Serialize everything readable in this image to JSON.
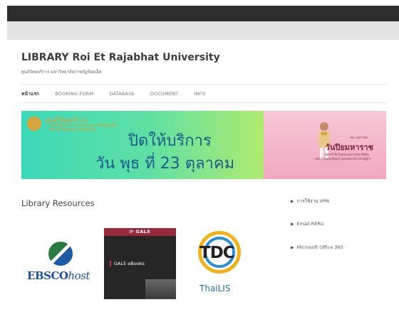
{
  "site": {
    "title": "LIBRARY Roi Et Rajabhat University",
    "subtitle": "ศูนย์วิทยบริการ มหาวิทยาลัยราชภัฏร้อยเอ็ด"
  },
  "nav": {
    "items": [
      {
        "label": "หน้าแรก",
        "active": true
      },
      {
        "label": "BOOKING FORM",
        "active": false
      },
      {
        "label": "DATABASE",
        "active": false
      },
      {
        "label": "DOCUMENT",
        "active": false
      },
      {
        "label": "INFO",
        "active": false
      }
    ]
  },
  "banner": {
    "org_name": "ศูนย์วิทยบริการ",
    "org_line2": "ศูนย์วิทยบริการ มหาวิทยาลัยราชภัฏร้อยเอ็ด",
    "org_line3": "Roi Et Rajabhat University",
    "line1": "ปิดให้บริการ",
    "line2": "วัน พุธ ที่ 23 ตุลาคม",
    "side_small": "๒๓ ตุลาคม",
    "side_big": "วันปิยมหาราช",
    "side_detail1": "น้อมรำลึกในพระมหากรุณาธิคุณ",
    "side_detail2": "พระบาทสมเด็จพระจุลจอมเกล้าเจ้าอยู่หัว",
    "colors": {
      "text": "#1e5a8a",
      "org": "#e8962a",
      "pink": "#f4b3c8"
    }
  },
  "resources": {
    "title": "Library Resources",
    "logos": [
      {
        "name": "EBSCOhost",
        "brand": "EBSCO",
        "suffix": "host"
      },
      {
        "name": "GALE eBooks",
        "brand": "GALE",
        "label": "GALE eBooks"
      },
      {
        "name": "TDC ThaiLIS",
        "brand": "TDC",
        "suffix": "ThaiLIS"
      }
    ]
  },
  "sidebar": {
    "links": [
      {
        "label": "การใช้งาน VPN"
      },
      {
        "label": "Email RERU"
      },
      {
        "label": "Microsoft Office 365"
      }
    ]
  }
}
